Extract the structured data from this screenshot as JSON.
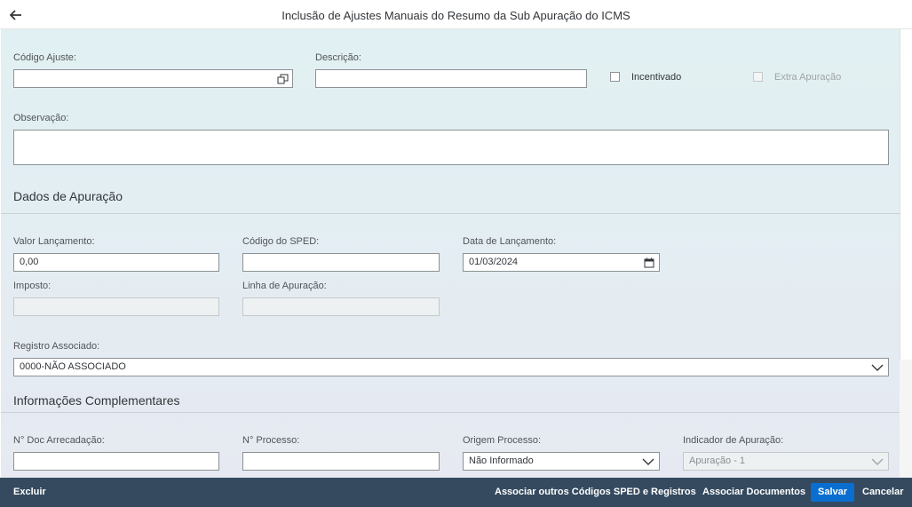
{
  "header": {
    "title": "Inclusão de Ajustes Manuais do Resumo da Sub Apuração do ICMS"
  },
  "general": {
    "codigo_ajuste_label": "Código Ajuste:",
    "codigo_ajuste_value": "",
    "descricao_label": "Descrição:",
    "descricao_value": "",
    "incentivado_label": "Incentivado",
    "extra_apuracao_label": "Extra Apuração",
    "observacao_label": "Observação:",
    "observacao_value": ""
  },
  "dados_apuracao": {
    "section_title": "Dados de Apuração",
    "valor_lancamento_label": "Valor Lançamento:",
    "valor_lancamento_value": "0,00",
    "codigo_sped_label": "Código do SPED:",
    "codigo_sped_value": "",
    "data_lancamento_label": "Data de Lançamento:",
    "data_lancamento_value": "01/03/2024",
    "imposto_label": "Imposto:",
    "imposto_value": "",
    "linha_apuracao_label": "Linha de Apuração:",
    "linha_apuracao_value": "",
    "registro_associado_label": "Registro Associado:",
    "registro_associado_value": "0000-NÃO ASSOCIADO"
  },
  "informacoes_complementares": {
    "section_title": "Informações Complementares",
    "doc_arrecadacao_label": "N° Doc Arrecadação:",
    "doc_arrecadacao_value": "",
    "processo_label": "N° Processo:",
    "processo_value": "",
    "origem_processo_label": "Origem Processo:",
    "origem_processo_value": "Não Informado",
    "indicador_apuracao_label": "Indicador de Apuração:",
    "indicador_apuracao_value": "Apuração - 1"
  },
  "footer": {
    "excluir_label": "Excluir",
    "associar_codigos_label": "Associar outros Códigos SPED e Registros",
    "associar_documentos_label": "Associar Documentos",
    "salvar_label": "Salvar",
    "cancelar_label": "Cancelar"
  },
  "colors": {
    "footer_bg": "#354a5f",
    "primary": "#0a6ed1"
  },
  "icons": [
    "arrow-left-icon",
    "value-help-icon",
    "calendar-icon",
    "chevron-down-icon"
  ]
}
